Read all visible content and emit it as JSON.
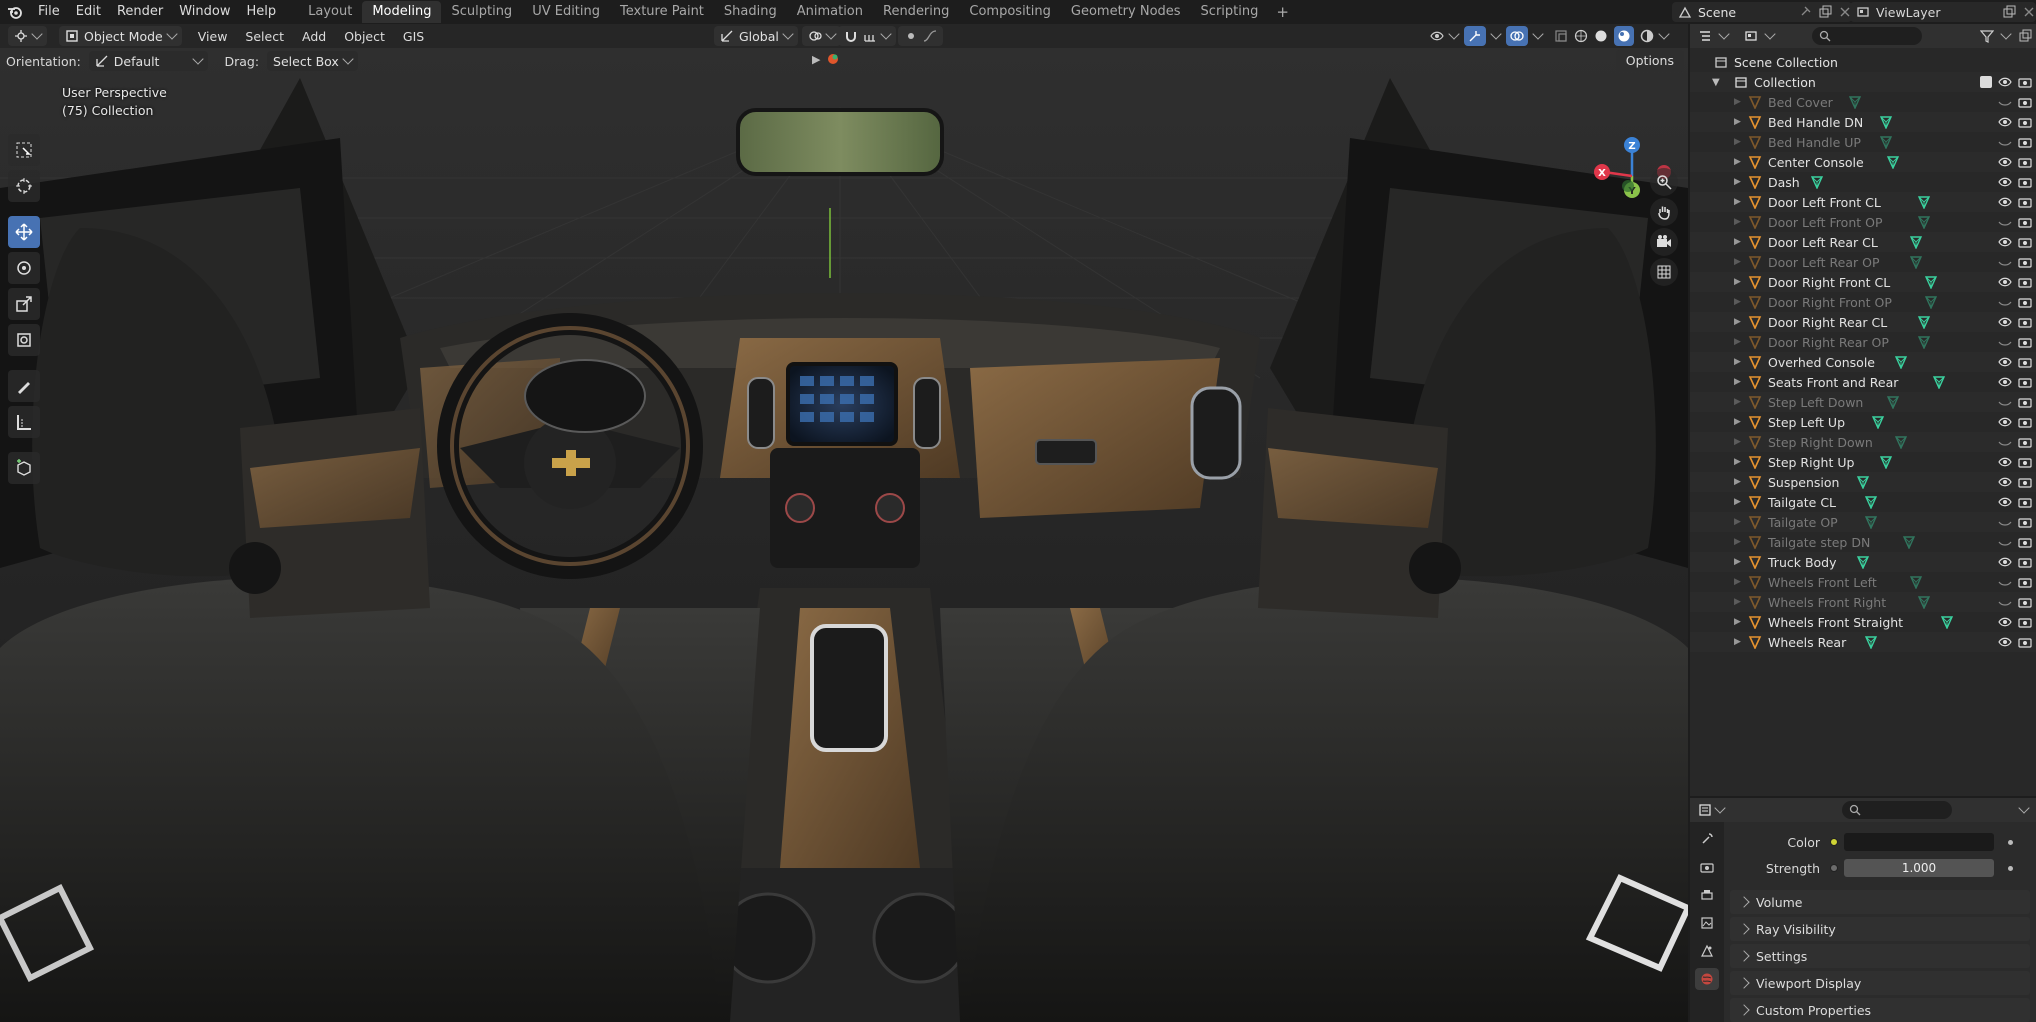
{
  "menubar": {
    "menus": [
      "File",
      "Edit",
      "Render",
      "Window",
      "Help"
    ],
    "workspaces": [
      "Layout",
      "Modeling",
      "Sculpting",
      "UV Editing",
      "Texture Paint",
      "Shading",
      "Animation",
      "Rendering",
      "Compositing",
      "Geometry Nodes",
      "Scripting"
    ],
    "active_workspace": "Modeling",
    "add_tab": "+",
    "scene": "Scene",
    "view_layer": "ViewLayer"
  },
  "viewport_header": {
    "mode": "Object Mode",
    "menus": [
      "View",
      "Select",
      "Add",
      "Object",
      "GIS"
    ],
    "transform_orientation": "Global"
  },
  "tool_settings": {
    "orientation_label": "Orientation:",
    "orientation_value": "Default",
    "drag_label": "Drag:",
    "drag_value": "Select Box",
    "options": "Options"
  },
  "viewport_info": {
    "view_name": "User Perspective",
    "collection": "(75) Collection"
  },
  "gizmo": {
    "z": "Z",
    "y": "Y",
    "x": "X"
  },
  "outliner": {
    "scene_collection": "Scene Collection",
    "collection": "Collection",
    "items": [
      {
        "name": "Bed Cover",
        "visible": false
      },
      {
        "name": "Bed Handle DN",
        "visible": true
      },
      {
        "name": "Bed Handle UP",
        "visible": false
      },
      {
        "name": "Center Console",
        "visible": true
      },
      {
        "name": "Dash",
        "visible": true
      },
      {
        "name": "Door Left Front CL",
        "visible": true
      },
      {
        "name": "Door Left Front OP",
        "visible": false
      },
      {
        "name": "Door Left Rear CL",
        "visible": true
      },
      {
        "name": "Door Left Rear OP",
        "visible": false
      },
      {
        "name": "Door Right Front CL",
        "visible": true
      },
      {
        "name": "Door Right Front OP",
        "visible": false
      },
      {
        "name": "Door Right Rear CL",
        "visible": true
      },
      {
        "name": "Door Right Rear OP",
        "visible": false
      },
      {
        "name": "Overhed Console",
        "visible": true
      },
      {
        "name": "Seats Front and Rear",
        "visible": true
      },
      {
        "name": "Step Left Down",
        "visible": false
      },
      {
        "name": "Step Left Up",
        "visible": true
      },
      {
        "name": "Step Right Down",
        "visible": false
      },
      {
        "name": "Step Right Up",
        "visible": true
      },
      {
        "name": "Suspension",
        "visible": true
      },
      {
        "name": "Tailgate CL",
        "visible": true
      },
      {
        "name": "Tailgate OP",
        "visible": false
      },
      {
        "name": "Tailgate step DN",
        "visible": false
      },
      {
        "name": "Truck Body",
        "visible": true
      },
      {
        "name": "Wheels Front Left",
        "visible": false
      },
      {
        "name": "Wheels Front Right",
        "visible": false
      },
      {
        "name": "Wheels Front Straight",
        "visible": true
      },
      {
        "name": "Wheels Rear",
        "visible": true
      }
    ]
  },
  "properties": {
    "color_label": "Color",
    "strength_label": "Strength",
    "strength_value": "1.000",
    "panels": [
      "Volume",
      "Ray Visibility",
      "Settings",
      "Viewport Display",
      "Custom Properties"
    ]
  },
  "colors": {
    "accent": "#4772b3",
    "axis_x": "#e0374a",
    "axis_y": "#8bc34a",
    "axis_z": "#3b82d6",
    "mesh_icon": "#e6932f",
    "data_icon": "#3ad29f"
  }
}
